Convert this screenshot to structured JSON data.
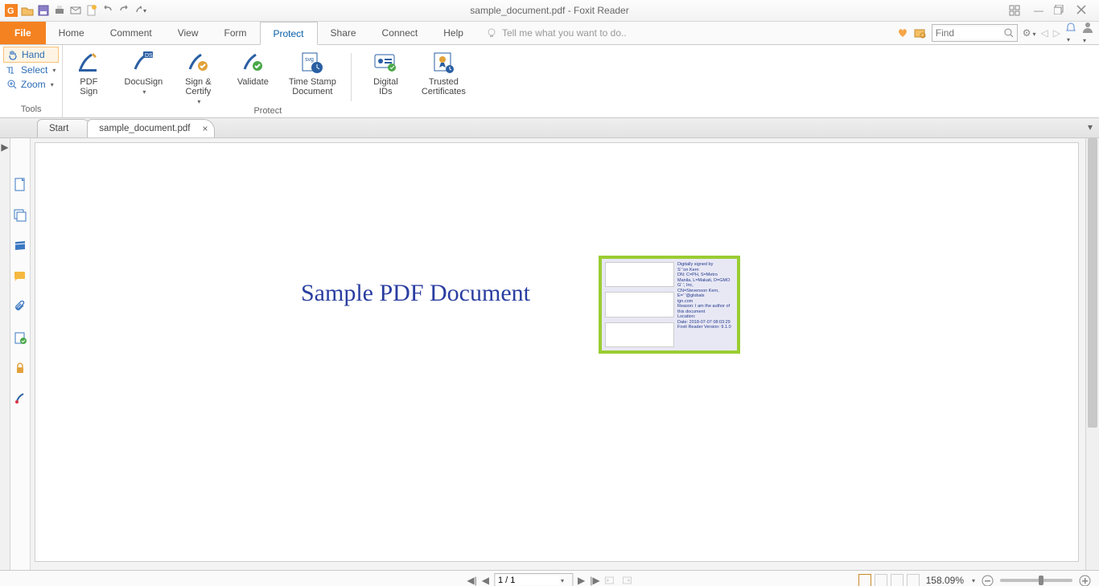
{
  "app": {
    "title": "sample_document.pdf - Foxit Reader"
  },
  "menu": {
    "file": "File",
    "tabs": [
      "Home",
      "Comment",
      "View",
      "Form",
      "Protect",
      "Share",
      "Connect",
      "Help"
    ],
    "active": "Protect",
    "tellme": "Tell me what you want to do..",
    "find_placeholder": "Find"
  },
  "tools_panel": {
    "hand": "Hand",
    "select": "Select",
    "zoom": "Zoom",
    "label": "Tools"
  },
  "ribbon": {
    "protect_label": "Protect",
    "pdf_sign": "PDF\nSign",
    "docusign": "DocuSign",
    "sign_certify": "Sign &\nCertify",
    "validate": "Validate",
    "timestamp": "Time Stamp\nDocument",
    "digital_ids": "Digital\nIDs",
    "trusted": "Trusted\nCertificates"
  },
  "doctabs": {
    "start": "Start",
    "doc": "sample_document.pdf"
  },
  "document": {
    "heading": "Sample PDF Document",
    "signature": {
      "l1": "Digitally signed by",
      "l2": "S'          'on Kern",
      "l3": "DN: C=PH, S=Metro",
      "l4": "Manila, L=Makati, O=GMO",
      "l5": "G'          ', Inc,",
      "l6": "CN=Stevenson Kern,",
      "l7": "E='                    '@globals",
      "l8": "ign.com",
      "l9": "Reason: I am the author of",
      "l10": "this document",
      "l11": "Location:",
      "l12": "Date: 2018-07-07 08:03:29",
      "l13": "Foxit Reader Version: 9.1.0"
    }
  },
  "status": {
    "page": "1 / 1",
    "zoom": "158.09%"
  }
}
